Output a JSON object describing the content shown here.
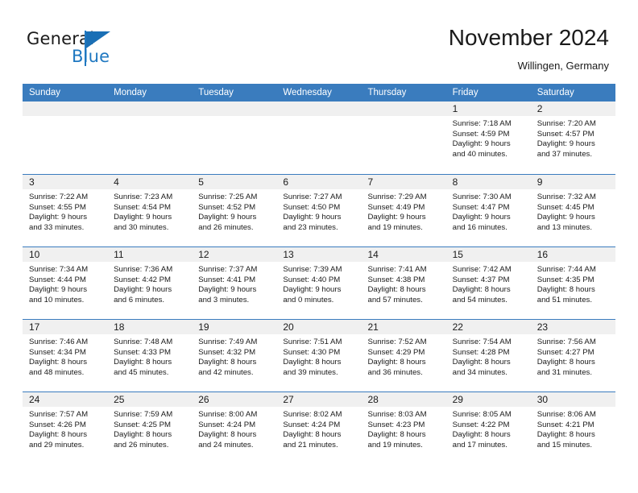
{
  "brand": {
    "name_part1": "General",
    "name_part2": "Blue",
    "accent_color": "#1f78c1"
  },
  "header": {
    "title": "November 2024",
    "subtitle": "Willingen, Germany"
  },
  "calendar": {
    "header_bg": "#3a7cbe",
    "day_band_bg": "#f0f0f0",
    "weekday_headers": [
      "Sunday",
      "Monday",
      "Tuesday",
      "Wednesday",
      "Thursday",
      "Friday",
      "Saturday"
    ],
    "weeks": [
      [
        {
          "day": "",
          "lines": []
        },
        {
          "day": "",
          "lines": []
        },
        {
          "day": "",
          "lines": []
        },
        {
          "day": "",
          "lines": []
        },
        {
          "day": "",
          "lines": []
        },
        {
          "day": "1",
          "lines": [
            "Sunrise: 7:18 AM",
            "Sunset: 4:59 PM",
            "Daylight: 9 hours",
            "and 40 minutes."
          ]
        },
        {
          "day": "2",
          "lines": [
            "Sunrise: 7:20 AM",
            "Sunset: 4:57 PM",
            "Daylight: 9 hours",
            "and 37 minutes."
          ]
        }
      ],
      [
        {
          "day": "3",
          "lines": [
            "Sunrise: 7:22 AM",
            "Sunset: 4:55 PM",
            "Daylight: 9 hours",
            "and 33 minutes."
          ]
        },
        {
          "day": "4",
          "lines": [
            "Sunrise: 7:23 AM",
            "Sunset: 4:54 PM",
            "Daylight: 9 hours",
            "and 30 minutes."
          ]
        },
        {
          "day": "5",
          "lines": [
            "Sunrise: 7:25 AM",
            "Sunset: 4:52 PM",
            "Daylight: 9 hours",
            "and 26 minutes."
          ]
        },
        {
          "day": "6",
          "lines": [
            "Sunrise: 7:27 AM",
            "Sunset: 4:50 PM",
            "Daylight: 9 hours",
            "and 23 minutes."
          ]
        },
        {
          "day": "7",
          "lines": [
            "Sunrise: 7:29 AM",
            "Sunset: 4:49 PM",
            "Daylight: 9 hours",
            "and 19 minutes."
          ]
        },
        {
          "day": "8",
          "lines": [
            "Sunrise: 7:30 AM",
            "Sunset: 4:47 PM",
            "Daylight: 9 hours",
            "and 16 minutes."
          ]
        },
        {
          "day": "9",
          "lines": [
            "Sunrise: 7:32 AM",
            "Sunset: 4:45 PM",
            "Daylight: 9 hours",
            "and 13 minutes."
          ]
        }
      ],
      [
        {
          "day": "10",
          "lines": [
            "Sunrise: 7:34 AM",
            "Sunset: 4:44 PM",
            "Daylight: 9 hours",
            "and 10 minutes."
          ]
        },
        {
          "day": "11",
          "lines": [
            "Sunrise: 7:36 AM",
            "Sunset: 4:42 PM",
            "Daylight: 9 hours",
            "and 6 minutes."
          ]
        },
        {
          "day": "12",
          "lines": [
            "Sunrise: 7:37 AM",
            "Sunset: 4:41 PM",
            "Daylight: 9 hours",
            "and 3 minutes."
          ]
        },
        {
          "day": "13",
          "lines": [
            "Sunrise: 7:39 AM",
            "Sunset: 4:40 PM",
            "Daylight: 9 hours",
            "and 0 minutes."
          ]
        },
        {
          "day": "14",
          "lines": [
            "Sunrise: 7:41 AM",
            "Sunset: 4:38 PM",
            "Daylight: 8 hours",
            "and 57 minutes."
          ]
        },
        {
          "day": "15",
          "lines": [
            "Sunrise: 7:42 AM",
            "Sunset: 4:37 PM",
            "Daylight: 8 hours",
            "and 54 minutes."
          ]
        },
        {
          "day": "16",
          "lines": [
            "Sunrise: 7:44 AM",
            "Sunset: 4:35 PM",
            "Daylight: 8 hours",
            "and 51 minutes."
          ]
        }
      ],
      [
        {
          "day": "17",
          "lines": [
            "Sunrise: 7:46 AM",
            "Sunset: 4:34 PM",
            "Daylight: 8 hours",
            "and 48 minutes."
          ]
        },
        {
          "day": "18",
          "lines": [
            "Sunrise: 7:48 AM",
            "Sunset: 4:33 PM",
            "Daylight: 8 hours",
            "and 45 minutes."
          ]
        },
        {
          "day": "19",
          "lines": [
            "Sunrise: 7:49 AM",
            "Sunset: 4:32 PM",
            "Daylight: 8 hours",
            "and 42 minutes."
          ]
        },
        {
          "day": "20",
          "lines": [
            "Sunrise: 7:51 AM",
            "Sunset: 4:30 PM",
            "Daylight: 8 hours",
            "and 39 minutes."
          ]
        },
        {
          "day": "21",
          "lines": [
            "Sunrise: 7:52 AM",
            "Sunset: 4:29 PM",
            "Daylight: 8 hours",
            "and 36 minutes."
          ]
        },
        {
          "day": "22",
          "lines": [
            "Sunrise: 7:54 AM",
            "Sunset: 4:28 PM",
            "Daylight: 8 hours",
            "and 34 minutes."
          ]
        },
        {
          "day": "23",
          "lines": [
            "Sunrise: 7:56 AM",
            "Sunset: 4:27 PM",
            "Daylight: 8 hours",
            "and 31 minutes."
          ]
        }
      ],
      [
        {
          "day": "24",
          "lines": [
            "Sunrise: 7:57 AM",
            "Sunset: 4:26 PM",
            "Daylight: 8 hours",
            "and 29 minutes."
          ]
        },
        {
          "day": "25",
          "lines": [
            "Sunrise: 7:59 AM",
            "Sunset: 4:25 PM",
            "Daylight: 8 hours",
            "and 26 minutes."
          ]
        },
        {
          "day": "26",
          "lines": [
            "Sunrise: 8:00 AM",
            "Sunset: 4:24 PM",
            "Daylight: 8 hours",
            "and 24 minutes."
          ]
        },
        {
          "day": "27",
          "lines": [
            "Sunrise: 8:02 AM",
            "Sunset: 4:24 PM",
            "Daylight: 8 hours",
            "and 21 minutes."
          ]
        },
        {
          "day": "28",
          "lines": [
            "Sunrise: 8:03 AM",
            "Sunset: 4:23 PM",
            "Daylight: 8 hours",
            "and 19 minutes."
          ]
        },
        {
          "day": "29",
          "lines": [
            "Sunrise: 8:05 AM",
            "Sunset: 4:22 PM",
            "Daylight: 8 hours",
            "and 17 minutes."
          ]
        },
        {
          "day": "30",
          "lines": [
            "Sunrise: 8:06 AM",
            "Sunset: 4:21 PM",
            "Daylight: 8 hours",
            "and 15 minutes."
          ]
        }
      ]
    ]
  }
}
